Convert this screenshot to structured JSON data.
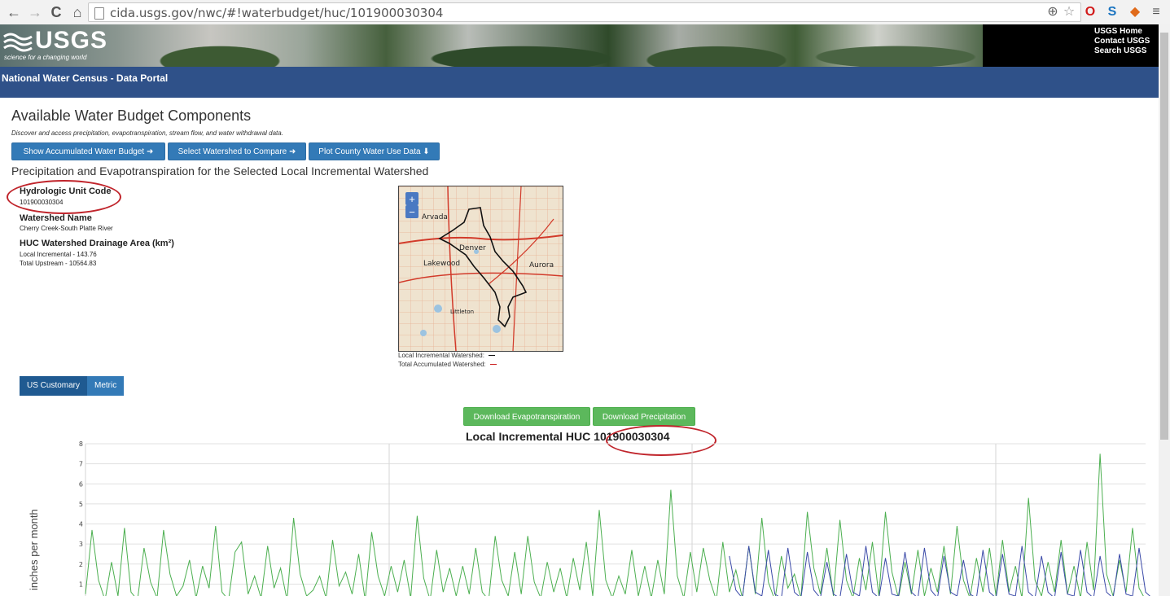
{
  "browser": {
    "url": "cida.usgs.gov/nwc/#!waterbudget/huc/101900030304",
    "nav": {
      "back": "←",
      "forward": "→",
      "reload": "C",
      "home": "⌂"
    }
  },
  "banner": {
    "logo_text": "USGS",
    "logo_tagline": "science for a changing world",
    "links": [
      "USGS Home",
      "Contact USGS",
      "Search USGS"
    ]
  },
  "header": {
    "portal_title": "National Water Census - Data Portal"
  },
  "page": {
    "title": "Available Water Budget Components",
    "subtitle": "Discover and access precipitation, evapotranspiration, stream flow, and water withdrawal data.",
    "buttons": {
      "accumulated": "Show Accumulated Water Budget ➜",
      "compare": "Select Watershed to Compare ➜",
      "county": "Plot County Water Use Data ⬇"
    },
    "section_title": "Precipitation and Evapotranspiration for the Selected Local Incremental Watershed"
  },
  "watershed": {
    "huc_label": "Hydrologic Unit Code",
    "huc_value": "101900030304",
    "name_label": "Watershed Name",
    "name_value": "Cherry Creek-South Platte River",
    "area_label": "HUC Watershed Drainage Area (km²)",
    "local_incremental": "Local Incremental - 143.76",
    "total_upstream": "Total Upstream - 10564.83"
  },
  "map": {
    "zoom_in": "+",
    "zoom_out": "−",
    "places": [
      "Arvada",
      "Denver",
      "Lakewood",
      "Aurora",
      "Littleton"
    ],
    "legend_local": "Local Incremental Watershed:",
    "legend_total": "Total Accumulated Watershed:",
    "legend_local_color": "#111111",
    "legend_total_color": "#cc2222"
  },
  "units": {
    "us": "US Customary",
    "metric": "Metric"
  },
  "downloads": {
    "evapo": "Download Evapotranspiration",
    "precip": "Download Precipitation"
  },
  "chart_title_prefix": "Local Incremental HUC",
  "chart_title_huc": "101900030304",
  "chart_data": {
    "type": "line",
    "title": "Local Incremental HUC 101900030304",
    "xlabel": "",
    "ylabel": "inches per month",
    "ylim": [
      0,
      8
    ],
    "yticks": [
      "1",
      "2",
      "3",
      "4",
      "5",
      "6",
      "7",
      "8"
    ],
    "grid": true,
    "series": [
      {
        "color": "#4caf50",
        "values": [
          0.5,
          3.7,
          1.2,
          0.2,
          2.1,
          0.4,
          3.8,
          0.6,
          0.2,
          2.8,
          1.1,
          0.3,
          3.7,
          1.5,
          0.4,
          0.9,
          2.2,
          0.3,
          1.9,
          0.8,
          3.9,
          0.6,
          0.2,
          2.6,
          3.1,
          0.5,
          1.4,
          0.3,
          2.9,
          0.8,
          1.8,
          0.2,
          4.3,
          1.5,
          0.4,
          0.7,
          1.4,
          0.3,
          3.2,
          0.9,
          1.6,
          0.5,
          2.5,
          0.2,
          3.6,
          1.4,
          0.4,
          1.9,
          0.6,
          2.2,
          0.3,
          4.4,
          1.3,
          0.2,
          2.7,
          0.6,
          1.8,
          0.4,
          1.9,
          0.5,
          2.8,
          0.6,
          0.2,
          3.4,
          1.2,
          0.4,
          2.6,
          0.5,
          3.4,
          1.1,
          0.3,
          2.1,
          0.6,
          1.8,
          0.3,
          2.3,
          0.7,
          3.1,
          0.4,
          4.7,
          1.2,
          0.3,
          1.4,
          0.5,
          2.7,
          0.4,
          1.9,
          0.3,
          2.2,
          0.5,
          5.7,
          1.4,
          0.3,
          2.6,
          0.6,
          2.8,
          1.2,
          0.2,
          3.1,
          0.6,
          1.7,
          0.3,
          2.9,
          0.5,
          4.3,
          1.1,
          0.2,
          2.4,
          0.8,
          1.5,
          0.3,
          4.6,
          1.8,
          0.5,
          2.8,
          0.4,
          4.2,
          1.2,
          0.3,
          2.3,
          0.7,
          3.1,
          0.4,
          4.6,
          1.6,
          0.3,
          2.1,
          0.5,
          2.7,
          0.4,
          1.8,
          0.6,
          2.9,
          0.5,
          3.9,
          1.2,
          0.3,
          2.3,
          0.6,
          2.8,
          0.4,
          3.2,
          0.6,
          1.9,
          0.3,
          5.3,
          1.2,
          0.4,
          2.1,
          0.6,
          3.2,
          0.5,
          1.9,
          0.3,
          3.1,
          0.7,
          7.5,
          1.5,
          0.4,
          2.2,
          0.6,
          3.8,
          0.8,
          0.2
        ]
      },
      {
        "color": "#3b4aa8",
        "start_index": 99,
        "values": [
          2.4,
          0.7,
          0.3,
          2.9,
          0.6,
          0.4,
          2.7,
          0.5,
          0.3,
          2.8,
          0.6,
          0.3,
          2.6,
          0.7,
          0.3,
          2.1,
          0.5,
          0.3,
          2.5,
          0.6,
          0.4,
          2.9,
          0.6,
          0.3,
          2.3,
          0.5,
          0.4,
          2.6,
          0.6,
          0.3,
          2.8,
          0.7,
          0.3,
          2.4,
          0.6,
          0.4,
          2.2,
          0.5,
          0.3,
          2.7,
          0.6,
          0.3,
          2.5,
          0.5,
          0.4,
          2.9,
          0.6,
          0.3,
          2.4,
          0.6,
          0.3,
          2.6,
          0.5,
          0.4,
          2.7,
          0.6,
          0.3,
          2.4,
          0.6,
          0.3,
          2.5,
          0.5,
          0.4,
          2.8,
          0.6,
          0.3
        ]
      }
    ]
  }
}
